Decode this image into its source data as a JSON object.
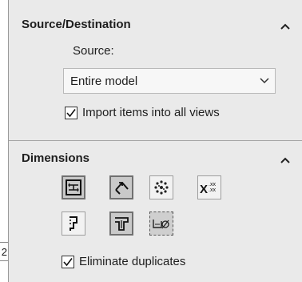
{
  "source_destination": {
    "title": "Source/Destination",
    "collapse_icon": "chevron-up-icon",
    "source_label": "Source:",
    "source_select": {
      "value": "Entire model",
      "icon": "chevron-down-icon"
    },
    "import_checkbox": {
      "label": "Import items into all views",
      "checked": true
    }
  },
  "dimensions": {
    "title": "Dimensions",
    "collapse_icon": "chevron-up-icon",
    "tools": [
      {
        "name": "marked-for-drawing-icon",
        "active": true
      },
      {
        "name": "not-marked-for-drawing-icon",
        "active": true
      },
      {
        "name": "instance-counts-icon",
        "active": false
      },
      {
        "name": "tolerance-dimensions-icon",
        "active": false
      },
      {
        "name": "hole-wizard-profiles-icon",
        "active": false
      },
      {
        "name": "hole-wizard-locations-icon",
        "active": true
      },
      {
        "name": "hole-callout-icon",
        "active": false
      }
    ],
    "eliminate_checkbox": {
      "label": "Eliminate duplicates",
      "checked": true
    }
  },
  "side_tab": {
    "label": "2"
  }
}
